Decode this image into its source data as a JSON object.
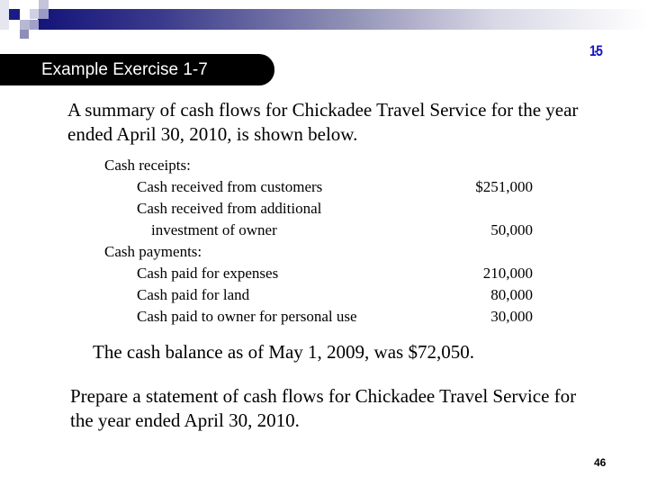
{
  "header": {
    "banner_title": "Example Exercise 1-7",
    "chapter_number": "1-5"
  },
  "intro": "A summary of cash flows for Chickadee Travel Service for the year ended April 30, 2010, is shown below.",
  "cash_flows": {
    "receipts_heading": "Cash receipts:",
    "receipts": [
      {
        "label": "Cash received from customers",
        "amount": "$251,000"
      },
      {
        "label": "Cash received from additional",
        "amount": ""
      },
      {
        "label": "investment of owner",
        "amount": "50,000"
      }
    ],
    "payments_heading": "Cash payments:",
    "payments": [
      {
        "label": "Cash paid for expenses",
        "amount": "210,000"
      },
      {
        "label": "Cash paid for land",
        "amount": "80,000"
      },
      {
        "label": "Cash paid to owner for personal use",
        "amount": "30,000"
      }
    ]
  },
  "balance_note": "The cash balance as of May 1, 2009, was $72,050.",
  "instruction": "Prepare a statement of cash flows for Chickadee Travel Service for the year ended April 30, 2010.",
  "page_number": "46"
}
